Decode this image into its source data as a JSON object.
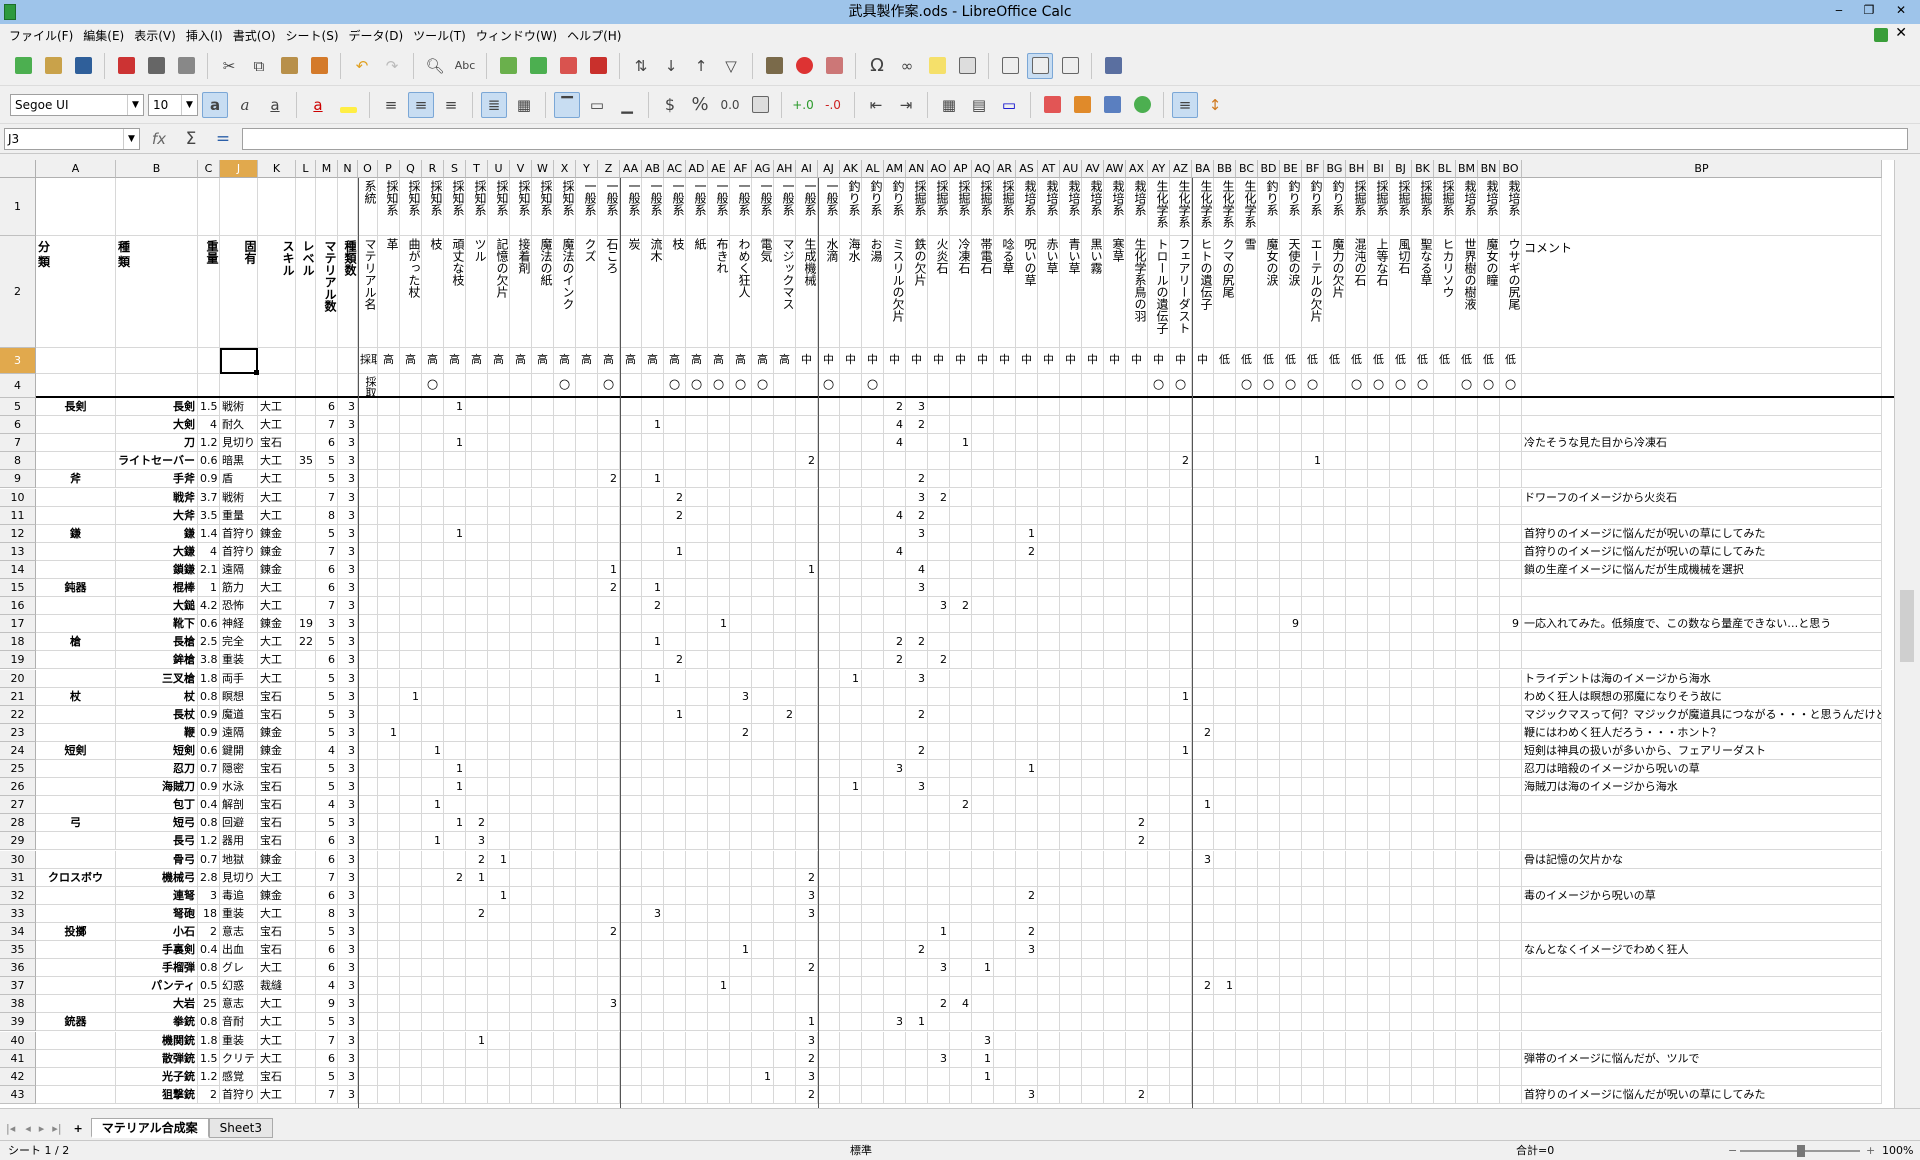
{
  "window": {
    "title": "武具製作案.ods - LibreOffice Calc"
  },
  "menu": [
    "ファイル(F)",
    "編集(E)",
    "表示(V)",
    "挿入(I)",
    "書式(O)",
    "シート(S)",
    "データ(D)",
    "ツール(T)",
    "ウィンドウ(W)",
    "ヘルプ(H)"
  ],
  "format": {
    "font_name": "Segoe UI",
    "font_size": "10"
  },
  "formula": {
    "cell_ref": "J3",
    "value": ""
  },
  "columns": [
    "A",
    "B",
    "C",
    "J",
    "K",
    "L",
    "M",
    "N",
    "O",
    "P",
    "Q",
    "R",
    "S",
    "T",
    "U",
    "V",
    "W",
    "X",
    "Y",
    "Z",
    "AA",
    "AB",
    "AC",
    "AD",
    "AE",
    "AF",
    "AG",
    "AH",
    "AI",
    "AJ",
    "AK",
    "AL",
    "AM",
    "AN",
    "AO",
    "AP",
    "AQ",
    "AR",
    "AS",
    "AT",
    "AU",
    "AV",
    "AW",
    "AX",
    "AY",
    "AZ",
    "BA",
    "BB",
    "BC",
    "BD",
    "BE",
    "BF",
    "BG",
    "BH",
    "BI",
    "BJ",
    "BK",
    "BL",
    "BM",
    "BN",
    "BO",
    "BP"
  ],
  "row_numbers": [
    "1",
    "2",
    "3",
    "4",
    "5",
    "6",
    "7",
    "8",
    "9",
    "10",
    "11",
    "12",
    "13",
    "14",
    "15",
    "16",
    "17",
    "18",
    "19",
    "20",
    "21",
    "22",
    "23",
    "24",
    "25",
    "26",
    "27",
    "28",
    "29",
    "30",
    "31",
    "32",
    "33",
    "34",
    "35",
    "36",
    "37",
    "38",
    "39",
    "40",
    "41",
    "42",
    "43"
  ],
  "header": {
    "group": [
      "系統",
      "採知系",
      "採知系",
      "採知系",
      "採知系",
      "採知系",
      "採知系",
      "採知系",
      "採知系",
      "採知系",
      "一般系",
      "一般系",
      "一般系",
      "一般系",
      "一般系",
      "一般系",
      "一般系",
      "一般系",
      "一般系",
      "一般系",
      "一般系",
      "一般系",
      "釣り系",
      "釣り系",
      "釣り系",
      "採掘系",
      "採掘系",
      "採掘系",
      "採掘系",
      "採掘系",
      "栽培系",
      "栽培系",
      "栽培系",
      "栽培系",
      "栽培系",
      "栽培系",
      "生化学系",
      "生化学系",
      "生化学系",
      "生化学系",
      "生化学系",
      "釣り系",
      "釣り系",
      "釣り系",
      "釣り系",
      "採掘系",
      "採掘系",
      "採掘系",
      "採掘系",
      "採掘系",
      "栽培系",
      "栽培系",
      "栽培系",
      "生化学系"
    ],
    "left": [
      "分類",
      "種類",
      "重量",
      "固有",
      "スキル",
      "レベル",
      "マテリアル数",
      "種類数"
    ],
    "material": [
      "マテリアル名",
      "革",
      "曲がった杖",
      "枝",
      "頑丈な枝",
      "ツル",
      "記憶の欠片",
      "接着剤",
      "魔法の紙",
      "魔法のインク",
      "クズ",
      "石ころ",
      "炭",
      "流木",
      "枝",
      "紙",
      "布きれ",
      "わめく狂人",
      "電気",
      "マジックマス",
      "生成機械",
      "水滴",
      "海水",
      "お湯",
      "ミスリルの欠片",
      "鉄の欠片",
      "火炎石",
      "冷凍石",
      "帯電石",
      "唸る草",
      "呪いの草",
      "赤い草",
      "青い草",
      "黒い霧",
      "寒草",
      "生化学系鳥の羽",
      "トロールの遺伝子",
      "フェアリーダスト",
      "ヒトの遺伝子",
      "クマの尻尾",
      "雪",
      "魔女の涙",
      "天使の涙",
      "エーテルの欠片",
      "魔力の欠片",
      "混沌の石",
      "上等な石",
      "風切石",
      "聖なる草",
      "ヒカリソウ",
      "世界樹の樹液",
      "魔女の瞳",
      "ウサギの尻尾"
    ],
    "rank": [
      "採取",
      "高",
      "高",
      "高",
      "高",
      "高",
      "高",
      "高",
      "高",
      "高",
      "高",
      "高",
      "高",
      "高",
      "高",
      "高",
      "高",
      "高",
      "高",
      "高",
      "中",
      "中",
      "中",
      "中",
      "中",
      "中",
      "中",
      "中",
      "中",
      "中",
      "中",
      "中",
      "中",
      "中",
      "中",
      "中",
      "中",
      "中",
      "中",
      "低",
      "低",
      "低",
      "低",
      "低",
      "低",
      "低",
      "低",
      "低",
      "低",
      "低",
      "低",
      "低",
      "低"
    ],
    "collect": [
      "採取収集",
      "",
      "",
      "○",
      "",
      "",
      "",
      "",
      "",
      "○",
      "",
      "○",
      "",
      "",
      "○",
      "○",
      "○",
      "○",
      "○",
      "",
      "",
      "○",
      "",
      "○",
      "",
      "",
      "",
      "",
      "",
      "",
      "",
      "",
      "",
      "",
      "",
      "",
      "○",
      "○",
      "",
      "",
      "○",
      "○",
      "○",
      "○",
      "",
      "○",
      "○",
      "○",
      "○",
      "",
      "○",
      "○",
      "○"
    ],
    "comment": "コメント"
  },
  "rows": [
    {
      "n": "5",
      "cat": "長剣",
      "type": "長剣",
      "w": "1.5",
      "uniq": "戦術",
      "skill": "大工",
      "lv": "",
      "mc": "6",
      "kc": "3",
      "vals": {
        "S": "1",
        "AM": "2",
        "AN": "3"
      },
      "note": ""
    },
    {
      "n": "6",
      "cat": "",
      "type": "大剣",
      "w": "4",
      "uniq": "耐久",
      "skill": "大工",
      "lv": "",
      "mc": "7",
      "kc": "3",
      "vals": {
        "AB": "1",
        "AM": "4",
        "AN": "2"
      },
      "note": ""
    },
    {
      "n": "7",
      "cat": "",
      "type": "刀",
      "w": "1.2",
      "uniq": "見切り",
      "skill": "宝石",
      "lv": "",
      "mc": "6",
      "kc": "3",
      "vals": {
        "S": "1",
        "AM": "4",
        "AP": "1"
      },
      "note": "冷たそうな見た目から冷凍石"
    },
    {
      "n": "8",
      "cat": "",
      "type": "ライトセーバー",
      "w": "0.6",
      "uniq": "暗黒",
      "skill": "大工",
      "lv": "35",
      "mc": "5",
      "kc": "3",
      "vals": {
        "AI": "2",
        "AZ": "2",
        "BF": "1"
      },
      "note": ""
    },
    {
      "n": "9",
      "cat": "斧",
      "type": "手斧",
      "w": "0.9",
      "uniq": "盾",
      "skill": "大工",
      "lv": "",
      "mc": "5",
      "kc": "3",
      "vals": {
        "Z": "2",
        "AB": "1",
        "AN": "2"
      },
      "note": ""
    },
    {
      "n": "10",
      "cat": "",
      "type": "戦斧",
      "w": "3.7",
      "uniq": "戦術",
      "skill": "大工",
      "lv": "",
      "mc": "7",
      "kc": "3",
      "vals": {
        "AC": "2",
        "AN": "3",
        "AO": "2"
      },
      "note": "ドワーフのイメージから火炎石"
    },
    {
      "n": "11",
      "cat": "",
      "type": "大斧",
      "w": "3.5",
      "uniq": "重量",
      "skill": "大工",
      "lv": "",
      "mc": "8",
      "kc": "3",
      "vals": {
        "AC": "2",
        "AM": "4",
        "AN": "2"
      },
      "note": ""
    },
    {
      "n": "12",
      "cat": "鎌",
      "type": "鎌",
      "w": "1.4",
      "uniq": "首狩り",
      "skill": "錬金",
      "lv": "",
      "mc": "5",
      "kc": "3",
      "vals": {
        "S": "1",
        "AN": "3",
        "AS": "1"
      },
      "note": "首狩りのイメージに悩んだが呪いの草にしてみた"
    },
    {
      "n": "13",
      "cat": "",
      "type": "大鎌",
      "w": "4",
      "uniq": "首狩り",
      "skill": "錬金",
      "lv": "",
      "mc": "7",
      "kc": "3",
      "vals": {
        "AC": "1",
        "AM": "4",
        "AS": "2"
      },
      "note": "首狩りのイメージに悩んだが呪いの草にしてみた"
    },
    {
      "n": "14",
      "cat": "",
      "type": "鎖鎌",
      "w": "2.1",
      "uniq": "遠隔",
      "skill": "錬金",
      "lv": "",
      "mc": "6",
      "kc": "3",
      "vals": {
        "Z": "1",
        "AI": "1",
        "AN": "4"
      },
      "note": "鎖の生産イメージに悩んだが生成機械を選択"
    },
    {
      "n": "15",
      "cat": "鈍器",
      "type": "棍棒",
      "w": "1",
      "uniq": "筋力",
      "skill": "大工",
      "lv": "",
      "mc": "6",
      "kc": "3",
      "vals": {
        "Z": "2",
        "AB": "1",
        "AN": "3"
      },
      "note": ""
    },
    {
      "n": "16",
      "cat": "",
      "type": "大鎚",
      "w": "4.2",
      "uniq": "恐怖",
      "skill": "大工",
      "lv": "",
      "mc": "7",
      "kc": "3",
      "vals": {
        "AB": "2",
        "AO": "3",
        "AP": "2"
      },
      "note": ""
    },
    {
      "n": "17",
      "cat": "",
      "type": "靴下",
      "w": "0.6",
      "uniq": "神経",
      "skill": "錬金",
      "lv": "19",
      "mc": "3",
      "kc": "3",
      "vals": {
        "AE": "1",
        "BE": "9",
        "BO": "9"
      },
      "note": "一応入れてみた。低頻度で、この数なら量産できない…と思う"
    },
    {
      "n": "18",
      "cat": "槍",
      "type": "長槍",
      "w": "2.5",
      "uniq": "完全",
      "skill": "大工",
      "lv": "22",
      "mc": "5",
      "kc": "3",
      "vals": {
        "AB": "1",
        "AM": "2",
        "AN": "2"
      },
      "note": ""
    },
    {
      "n": "19",
      "cat": "",
      "type": "鉾槍",
      "w": "3.8",
      "uniq": "重装",
      "skill": "大工",
      "lv": "",
      "mc": "6",
      "kc": "3",
      "vals": {
        "AC": "2",
        "AM": "2",
        "AO": "2"
      },
      "note": ""
    },
    {
      "n": "20",
      "cat": "",
      "type": "三叉槍",
      "w": "1.8",
      "uniq": "両手",
      "skill": "大工",
      "lv": "",
      "mc": "5",
      "kc": "3",
      "vals": {
        "AB": "1",
        "AK": "1",
        "AN": "3"
      },
      "note": "トライデントは海のイメージから海水"
    },
    {
      "n": "21",
      "cat": "杖",
      "type": "杖",
      "w": "0.8",
      "uniq": "瞑想",
      "skill": "宝石",
      "lv": "",
      "mc": "5",
      "kc": "3",
      "vals": {
        "Q": "1",
        "AF": "3",
        "AZ": "1"
      },
      "note": "わめく狂人は瞑想の邪魔になりそう故に"
    },
    {
      "n": "22",
      "cat": "",
      "type": "長杖",
      "w": "0.9",
      "uniq": "魔道",
      "skill": "宝石",
      "lv": "",
      "mc": "5",
      "kc": "3",
      "vals": {
        "AC": "1",
        "AH": "2",
        "AN": "2"
      },
      "note": "マジックマスって何？マジックが魔道具につながる・・・と思うんだけど"
    },
    {
      "n": "23",
      "cat": "",
      "type": "鞭",
      "w": "0.9",
      "uniq": "遠隔",
      "skill": "錬金",
      "lv": "",
      "mc": "5",
      "kc": "3",
      "vals": {
        "P": "1",
        "AF": "2",
        "BA": "2"
      },
      "note": "鞭にはわめく狂人だろう・・・ホント？"
    },
    {
      "n": "24",
      "cat": "短剣",
      "type": "短剣",
      "w": "0.6",
      "uniq": "鍵開",
      "skill": "錬金",
      "lv": "",
      "mc": "4",
      "kc": "3",
      "vals": {
        "R": "1",
        "AN": "2",
        "AZ": "1"
      },
      "note": "短剣は神具の扱いが多いから、フェアリーダスト"
    },
    {
      "n": "25",
      "cat": "",
      "type": "忍刀",
      "w": "0.7",
      "uniq": "隠密",
      "skill": "宝石",
      "lv": "",
      "mc": "5",
      "kc": "3",
      "vals": {
        "S": "1",
        "AM": "3",
        "AS": "1"
      },
      "note": "忍刀は暗殺のイメージから呪いの草"
    },
    {
      "n": "26",
      "cat": "",
      "type": "海賊刀",
      "w": "0.9",
      "uniq": "水泳",
      "skill": "宝石",
      "lv": "",
      "mc": "5",
      "kc": "3",
      "vals": {
        "S": "1",
        "AK": "1",
        "AN": "3"
      },
      "note": "海賊刀は海のイメージから海水"
    },
    {
      "n": "27",
      "cat": "",
      "type": "包丁",
      "w": "0.4",
      "uniq": "解剖",
      "skill": "宝石",
      "lv": "",
      "mc": "4",
      "kc": "3",
      "vals": {
        "R": "1",
        "AP": "2",
        "BA": "1"
      },
      "note": ""
    },
    {
      "n": "28",
      "cat": "弓",
      "type": "短弓",
      "w": "0.8",
      "uniq": "回避",
      "skill": "宝石",
      "lv": "",
      "mc": "5",
      "kc": "3",
      "vals": {
        "S": "1",
        "T": "2",
        "AX": "2"
      },
      "note": ""
    },
    {
      "n": "29",
      "cat": "",
      "type": "長弓",
      "w": "1.2",
      "uniq": "器用",
      "skill": "宝石",
      "lv": "",
      "mc": "6",
      "kc": "3",
      "vals": {
        "R": "1",
        "T": "3",
        "AX": "2"
      },
      "note": ""
    },
    {
      "n": "30",
      "cat": "",
      "type": "骨弓",
      "w": "0.7",
      "uniq": "地獄",
      "skill": "錬金",
      "lv": "",
      "mc": "6",
      "kc": "3",
      "vals": {
        "T": "2",
        "U": "1",
        "BA": "3"
      },
      "note": "骨は記憶の欠片かな"
    },
    {
      "n": "31",
      "cat": "クロスボウ",
      "type": "機械弓",
      "w": "2.8",
      "uniq": "見切り",
      "skill": "大工",
      "lv": "",
      "mc": "7",
      "kc": "3",
      "vals": {
        "S": "2",
        "T": "1",
        "AI": "2"
      },
      "note": ""
    },
    {
      "n": "32",
      "cat": "",
      "type": "連弩",
      "w": "3",
      "uniq": "毒追",
      "skill": "錬金",
      "lv": "",
      "mc": "6",
      "kc": "3",
      "vals": {
        "U": "1",
        "AI": "3",
        "AS": "2"
      },
      "note": "毒のイメージから呪いの草"
    },
    {
      "n": "33",
      "cat": "",
      "type": "弩砲",
      "w": "18",
      "uniq": "重装",
      "skill": "大工",
      "lv": "",
      "mc": "8",
      "kc": "3",
      "vals": {
        "T": "2",
        "AB": "3",
        "AI": "3"
      },
      "note": ""
    },
    {
      "n": "34",
      "cat": "投擲",
      "type": "小石",
      "w": "2",
      "uniq": "意志",
      "skill": "宝石",
      "lv": "",
      "mc": "5",
      "kc": "3",
      "vals": {
        "Z": "2",
        "AO": "1",
        "AS": "2"
      },
      "note": ""
    },
    {
      "n": "35",
      "cat": "",
      "type": "手裏剣",
      "w": "0.4",
      "uniq": "出血",
      "skill": "宝石",
      "lv": "",
      "mc": "6",
      "kc": "3",
      "vals": {
        "AF": "1",
        "AN": "2",
        "AS": "3"
      },
      "note": "なんとなくイメージでわめく狂人"
    },
    {
      "n": "36",
      "cat": "",
      "type": "手榴弾",
      "w": "0.8",
      "uniq": "グレ",
      "skill": "大工",
      "lv": "",
      "mc": "6",
      "kc": "3",
      "vals": {
        "AI": "2",
        "AO": "3",
        "AQ": "1"
      },
      "note": ""
    },
    {
      "n": "37",
      "cat": "",
      "type": "パンティ",
      "w": "0.5",
      "uniq": "幻惑",
      "skill": "裁縫",
      "lv": "",
      "mc": "4",
      "kc": "3",
      "vals": {
        "AE": "1",
        "BA": "2",
        "BB": "1"
      },
      "note": ""
    },
    {
      "n": "38",
      "cat": "",
      "type": "大岩",
      "w": "25",
      "uniq": "意志",
      "skill": "大工",
      "lv": "",
      "mc": "9",
      "kc": "3",
      "vals": {
        "Z": "3",
        "AO": "2",
        "AP": "4"
      },
      "note": ""
    },
    {
      "n": "39",
      "cat": "銃器",
      "type": "拳銃",
      "w": "0.8",
      "uniq": "音耐",
      "skill": "大工",
      "lv": "",
      "mc": "5",
      "kc": "3",
      "vals": {
        "AI": "1",
        "AM": "3",
        "AN": "1"
      },
      "note": ""
    },
    {
      "n": "40",
      "cat": "",
      "type": "機関銃",
      "w": "1.8",
      "uniq": "重装",
      "skill": "大工",
      "lv": "",
      "mc": "7",
      "kc": "3",
      "vals": {
        "T": "1",
        "AI": "3",
        "AQ": "3"
      },
      "note": ""
    },
    {
      "n": "41",
      "cat": "",
      "type": "散弾銃",
      "w": "1.5",
      "uniq": "クリテ",
      "skill": "大工",
      "lv": "",
      "mc": "6",
      "kc": "3",
      "vals": {
        "AI": "2",
        "AO": "3",
        "AQ": "1"
      },
      "note": "弾帯のイメージに悩んだが、ツルで"
    },
    {
      "n": "42",
      "cat": "",
      "type": "光子銃",
      "w": "1.2",
      "uniq": "感覚",
      "skill": "宝石",
      "lv": "",
      "mc": "5",
      "kc": "3",
      "vals": {
        "AG": "1",
        "AI": "3",
        "AQ": "1"
      },
      "note": ""
    },
    {
      "n": "43",
      "cat": "",
      "type": "狙撃銃",
      "w": "2",
      "uniq": "首狩り",
      "skill": "大工",
      "lv": "",
      "mc": "7",
      "kc": "3",
      "vals": {
        "AI": "2",
        "AS": "3",
        "AX": "2"
      },
      "note": "首狩りのイメージに悩んだが呪いの草にしてみた"
    }
  ],
  "sheets": [
    "マテリアル合成案",
    "Sheet3"
  ],
  "status": {
    "sheet_pos": "シート 1 / 2",
    "style": "標準",
    "sum": "合計=0",
    "zoom": "100%"
  }
}
